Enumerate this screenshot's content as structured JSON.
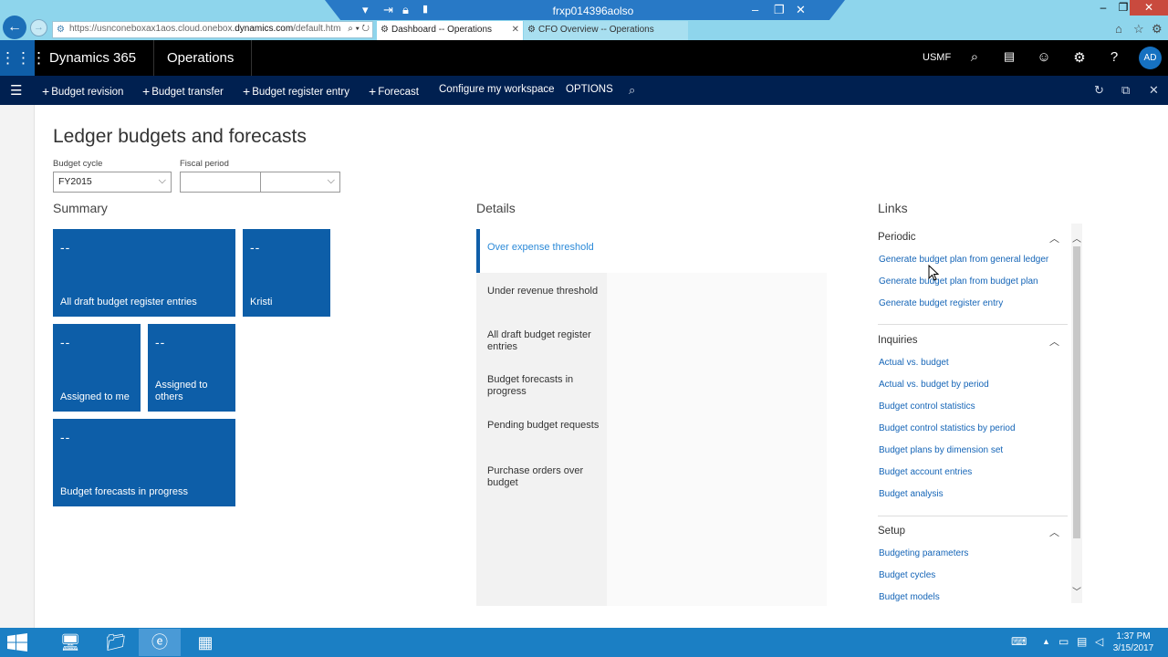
{
  "browser": {
    "rdp_title": "frxp014396aolso",
    "address_prefix": "https://usnconeboxax1aos.cloud.onebox.",
    "address_domain": "dynamics.com",
    "address_suffix": "/default.htm",
    "tabs": [
      {
        "label": "Dashboard -- Operations",
        "active": true
      },
      {
        "label": "CFO Overview -- Operations",
        "active": false
      }
    ]
  },
  "header": {
    "app_name": "Dynamics 365",
    "module": "Operations",
    "company": "USMF",
    "avatar_initials": "AD"
  },
  "actionbar": {
    "items": [
      {
        "label": "Budget revision",
        "plus": true
      },
      {
        "label": "Budget transfer",
        "plus": true
      },
      {
        "label": "Budget register entry",
        "plus": true
      },
      {
        "label": "Forecast",
        "plus": true
      },
      {
        "label": "Configure my workspace",
        "plus": false
      },
      {
        "label": "OPTIONS",
        "plus": false
      }
    ]
  },
  "page": {
    "title": "Ledger budgets and forecasts",
    "budget_cycle_label": "Budget cycle",
    "budget_cycle_value": "FY2015",
    "fiscal_period_label": "Fiscal period",
    "fiscal_period_value": ""
  },
  "summary": {
    "heading": "Summary",
    "tiles": [
      {
        "count": "--",
        "label": "All draft budget register entries"
      },
      {
        "count": "--",
        "label": "Kristi"
      },
      {
        "count": "--",
        "label": "Assigned to me"
      },
      {
        "count": "--",
        "label": "Assigned to others"
      },
      {
        "count": "--",
        "label": "Budget forecasts in progress"
      }
    ]
  },
  "details": {
    "heading": "Details",
    "items": [
      "Over expense threshold",
      "Under revenue threshold",
      "All draft budget register entries",
      "Budget forecasts in progress",
      "Pending budget requests",
      "Purchase orders over budget"
    ],
    "selected_index": 0
  },
  "links": {
    "heading": "Links",
    "groups": [
      {
        "title": "Periodic",
        "items": [
          "Generate budget plan from general ledger",
          "Generate budget plan from budget plan",
          "Generate budget register entry"
        ]
      },
      {
        "title": "Inquiries",
        "items": [
          "Actual vs. budget",
          "Actual vs. budget by period",
          "Budget control statistics",
          "Budget control statistics by period",
          "Budget plans by dimension set",
          "Budget account entries",
          "Budget analysis"
        ]
      },
      {
        "title": "Setup",
        "items": [
          "Budgeting parameters",
          "Budget cycles",
          "Budget models"
        ]
      }
    ]
  },
  "taskbar": {
    "time": "1:37 PM",
    "date": "3/15/2017"
  },
  "colors": {
    "tile": "#0d5ea8",
    "actionbar": "#002050",
    "link": "#1565b7",
    "browser_chrome": "#8ed5ec"
  }
}
